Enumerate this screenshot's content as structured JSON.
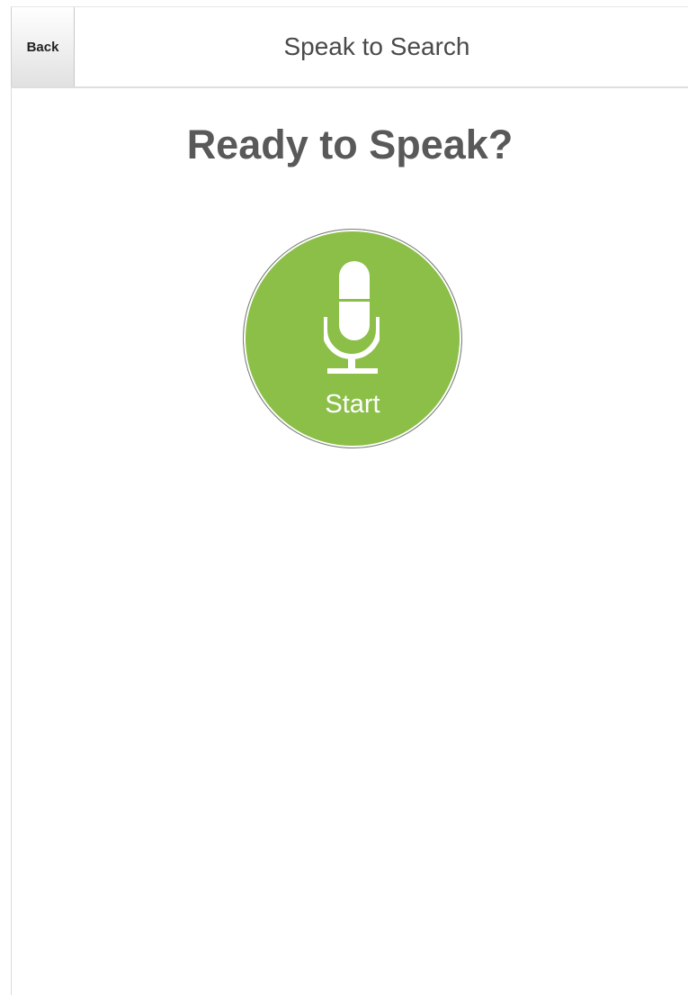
{
  "header": {
    "back_label": "Back",
    "title": "Speak to Search"
  },
  "main": {
    "heading": "Ready to Speak?",
    "mic_button": {
      "label": "Start",
      "icon": "microphone-icon",
      "color": "#8bbf48"
    }
  },
  "colors": {
    "accent": "#8bbf48",
    "heading_text": "#595959",
    "header_text": "#4a4a4a"
  }
}
